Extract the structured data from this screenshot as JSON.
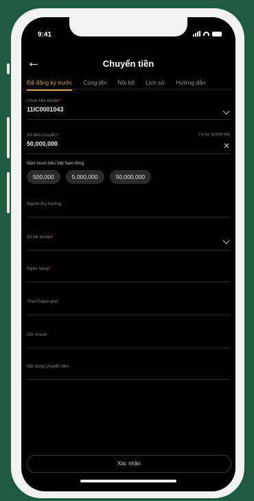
{
  "status_bar": {
    "time": "9:41"
  },
  "header": {
    "title": "Chuyển tiền"
  },
  "tabs": [
    {
      "label": "Đã đăng ký trước",
      "active": true
    },
    {
      "label": "Cùng tên",
      "active": false
    },
    {
      "label": "Nội bộ",
      "active": false
    },
    {
      "label": "Lịch sử",
      "active": false
    },
    {
      "label": "Hướng dẫn",
      "active": false
    }
  ],
  "form": {
    "source_account": {
      "label": "Chọn tiểu khoản",
      "value": "11IC0001043"
    },
    "amount": {
      "label": "Số tiền chuyển",
      "value": "50,000,000",
      "limit": "Tối đa: 50,000,000"
    },
    "amount_in_words": "Năm mươi triệu Việt Nam đồng",
    "quick_amounts": [
      "500,000",
      "5,000,000",
      "50,000,000"
    ],
    "beneficiary": {
      "label": "Người thụ hưởng"
    },
    "account_number": {
      "label": "Số tài khoản"
    },
    "bank": {
      "label": "Ngân hàng"
    },
    "province": {
      "label": "Tỉnh/Thành phố"
    },
    "branch": {
      "label": "Chi nhánh"
    },
    "content": {
      "label": "Nội dung chuyển tiền"
    }
  },
  "submit_label": "Xác nhận",
  "colors": {
    "accent": "#d8a24a",
    "background": "#000000",
    "required": "#e0424c",
    "frame_bg": "#1e5a3e"
  },
  "icons": [
    "back-arrow-icon",
    "chevron-down-icon",
    "clear-icon",
    "signal-icon",
    "wifi-icon",
    "battery-icon"
  ]
}
